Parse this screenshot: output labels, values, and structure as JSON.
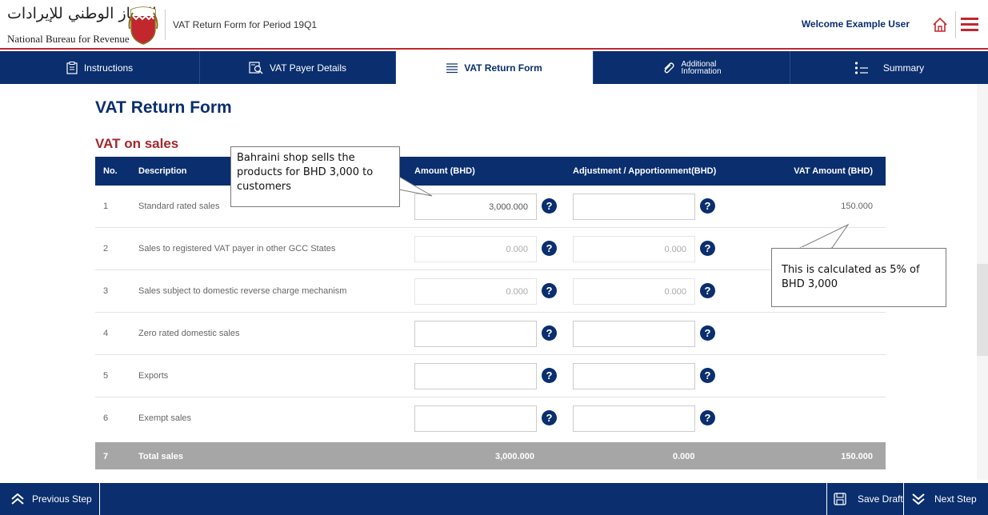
{
  "header": {
    "logo_arabic": "الجهاز الوطني للإيرادات",
    "logo_english": "National Bureau for Revenue",
    "form_title": "VAT Return Form for Period 19Q1",
    "welcome": "Welcome Example User"
  },
  "tabs": [
    {
      "label": "Instructions",
      "icon": "clipboard-icon",
      "active": false
    },
    {
      "label": "VAT Payer Details",
      "icon": "person-search-icon",
      "active": false
    },
    {
      "label": "VAT Return Form",
      "icon": "list-icon",
      "active": true
    },
    {
      "label_line1": "Additional",
      "label_line2": "Information",
      "icon": "paperclip-icon",
      "active": false
    },
    {
      "label": "Summary",
      "icon": "summary-list-icon",
      "active": false
    }
  ],
  "main": {
    "page_title": "VAT Return Form",
    "section_title": "VAT on sales"
  },
  "table": {
    "headers": {
      "no": "No.",
      "description": "Description",
      "amount": "Amount (BHD)",
      "adjustment": "Adjustment / Apportionment(BHD)",
      "vat_amount": "VAT Amount (BHD)"
    },
    "rows": [
      {
        "no": "1",
        "description": "Standard rated sales",
        "amount": "3,000.000",
        "adjustment": "",
        "vat": "150.000",
        "disabled": false
      },
      {
        "no": "2",
        "description": "Sales to registered VAT payer in other GCC States",
        "amount": "0.000",
        "adjustment": "0.000",
        "vat": "",
        "disabled": true
      },
      {
        "no": "3",
        "description": "Sales subject to domestic reverse charge mechanism",
        "amount": "0.000",
        "adjustment": "0.000",
        "vat": "",
        "disabled": true
      },
      {
        "no": "4",
        "description": "Zero rated domestic sales",
        "amount": "",
        "adjustment": "",
        "vat": "",
        "disabled": false
      },
      {
        "no": "5",
        "description": "Exports",
        "amount": "",
        "adjustment": "",
        "vat": "",
        "disabled": false
      },
      {
        "no": "6",
        "description": "Exempt sales",
        "amount": "",
        "adjustment": "",
        "vat": "",
        "disabled": false
      }
    ],
    "total": {
      "no": "7",
      "label": "Total sales",
      "amount": "3,000.000",
      "adjustment": "0.000",
      "vat": "150.000"
    },
    "help_glyph": "?"
  },
  "callouts": {
    "shop": "Bahraini shop sells the products for BHD 3,000 to customers",
    "calc": "This is calculated as 5% of BHD 3,000"
  },
  "footer": {
    "previous": "Previous Step",
    "save": "Save Draft",
    "next": "Next Step"
  },
  "colors": {
    "brand_blue": "#0a2e6e",
    "brand_red": "#c1272d",
    "section_red": "#a4262c",
    "total_gray": "#a6a6a6"
  }
}
